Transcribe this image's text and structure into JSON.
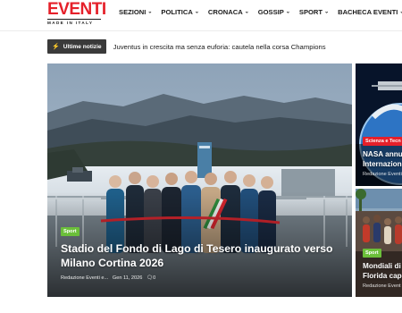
{
  "logo": {
    "main": "EVENTI",
    "sub": "MADE IN ITALY"
  },
  "nav": [
    {
      "label": "SEZIONI"
    },
    {
      "label": "POLITICA"
    },
    {
      "label": "CRONACA"
    },
    {
      "label": "GOSSIP"
    },
    {
      "label": "SPORT"
    },
    {
      "label": "BACHECA EVENTI"
    }
  ],
  "ticker": {
    "badge": "Ultime notizie",
    "headline": "Juventus in crescita ma senza euforia: cautela nella corsa Champions"
  },
  "hero": {
    "tag": "Sport",
    "title": "Stadio del Fondo di Lago di Tesero inaugurato verso Milano Cortina 2026",
    "author": "Redazione Eventi e...",
    "date": "Gen 11, 2026",
    "comments": "0"
  },
  "side_cards": [
    {
      "tag": "Scienza e Tecn",
      "title_line1": "NASA annu",
      "title_line2": "Internazion",
      "meta": "Redazione Eventi"
    },
    {
      "tag": "Sport",
      "title_line1": "Mondiali di C",
      "title_line2": "Florida capi",
      "meta": "Redazione Event"
    }
  ],
  "colors": {
    "brand_red": "#e5202a",
    "tag_green": "#6bbf3a",
    "ticker_bg": "#3a3a3a"
  }
}
